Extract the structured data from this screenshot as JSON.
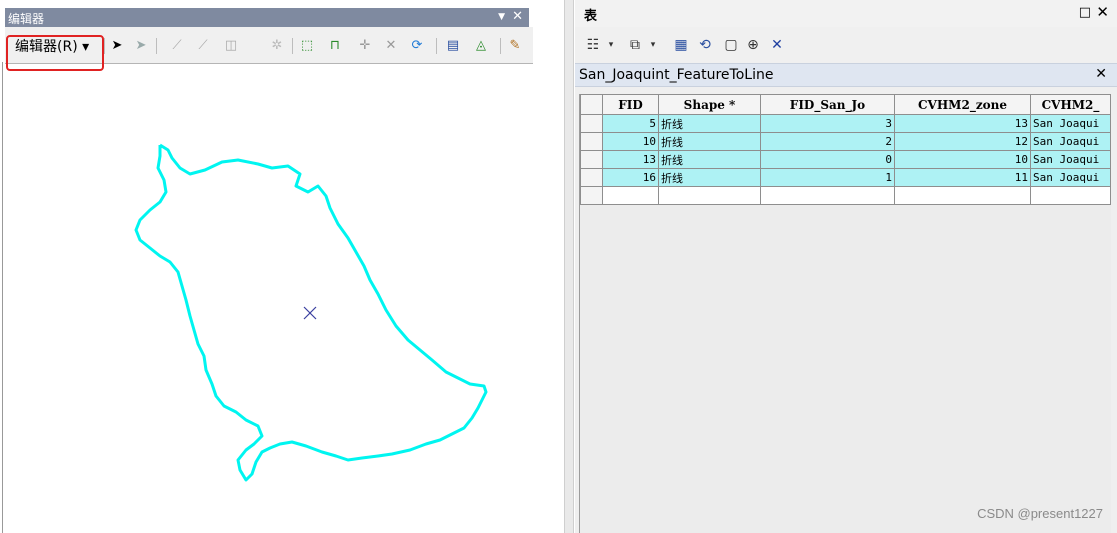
{
  "editor_window": {
    "title": "编辑器",
    "close_glyph": "✕",
    "menu_button_label": "编辑器(R) ▾",
    "map_center_marker": "×"
  },
  "table_window": {
    "title": "表",
    "restore_glyph": "□",
    "close_glyph": "✕",
    "layer_tab": "San_Joaquint_FeatureToLine",
    "tab_close_glyph": "✕",
    "columns": [
      "FID",
      "Shape *",
      "FID_San_Jo",
      "CVHM2_zone",
      "CVHM2_"
    ],
    "rows": [
      {
        "FID": "5",
        "Shape": "折线",
        "FID_San_Jo": "3",
        "CVHM2_zone": "13",
        "CVHM2_": "San Joaqui"
      },
      {
        "FID": "10",
        "Shape": "折线",
        "FID_San_Jo": "2",
        "CVHM2_zone": "12",
        "CVHM2_": "San Joaqui"
      },
      {
        "FID": "13",
        "Shape": "折线",
        "FID_San_Jo": "0",
        "CVHM2_zone": "10",
        "CVHM2_": "San Joaqui"
      },
      {
        "FID": "16",
        "Shape": "折线",
        "FID_San_Jo": "1",
        "CVHM2_zone": "11",
        "CVHM2_": "San Joaqui"
      }
    ]
  },
  "watermark": "CSDN @present1227",
  "colors": {
    "polygon_outline": "#00f5f0",
    "selected_row": "#aef2f4",
    "highlight_box": "#e02222"
  }
}
